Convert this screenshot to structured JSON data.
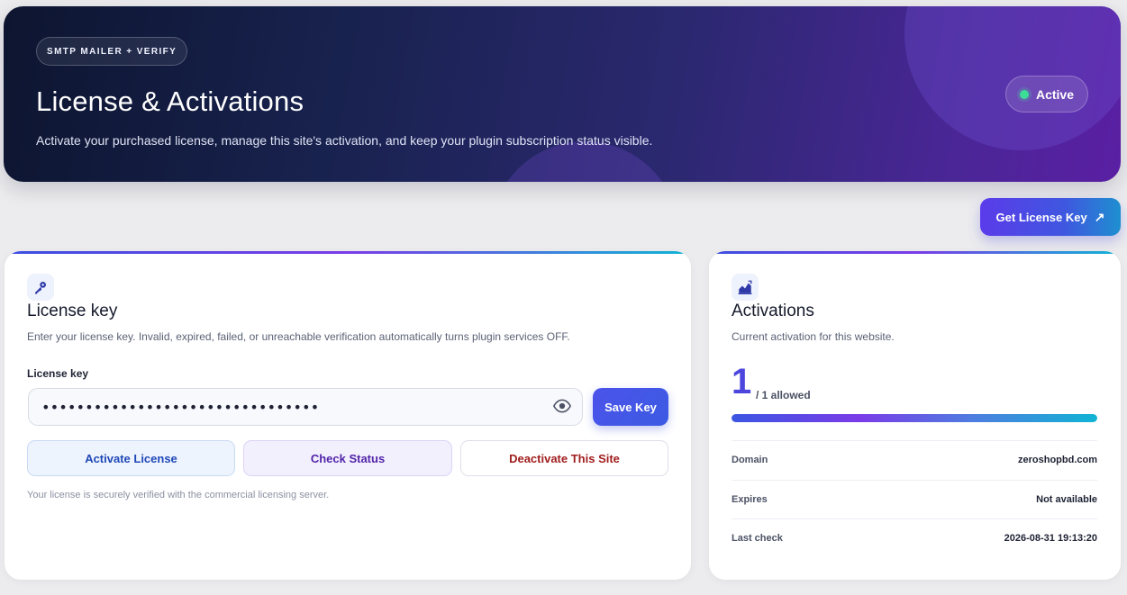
{
  "hero": {
    "eyebrow": "SMTP MAILER + VERIFY",
    "title": "License & Activations",
    "subtitle": "Activate your purchased license, manage this site's activation, and keep your plugin subscription status visible.",
    "status": "Active"
  },
  "actions": {
    "get_license_key": "Get License Key",
    "get_license_key_icon": "external-arrow-icon"
  },
  "license_card": {
    "icon": "key-icon",
    "title": "License key",
    "description": "Enter your license key. Invalid, expired, failed, or unreachable verification automatically turns plugin services OFF.",
    "field_label": "License key",
    "key_value": "••••••••••••••••••••••••••••••••",
    "save_label": "Save Key",
    "activate_label": "Activate License",
    "check_label": "Check Status",
    "deactivate_label": "Deactivate This Site",
    "footnote": "Your license is securely verified with the commercial licensing server."
  },
  "activations_card": {
    "icon": "chart-icon",
    "title": "Activations",
    "description": "Current activation for this website.",
    "count": "1",
    "allowed": "/ 1 allowed",
    "progress_fraction": 1.0,
    "rows": [
      {
        "label": "Domain",
        "value": "zeroshopbd.com"
      },
      {
        "label": "Expires",
        "value": "Not available"
      },
      {
        "label": "Last check",
        "value": "2026-08-31 19:13:20"
      }
    ]
  },
  "colors": {
    "accent": "#4d46de",
    "status_dot": "#3ddc97",
    "danger": "#a11d1d"
  }
}
